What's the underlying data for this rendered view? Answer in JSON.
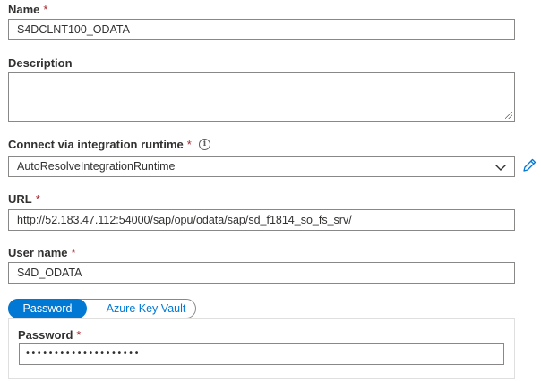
{
  "name": {
    "label": "Name",
    "required_marker": "*",
    "value": "S4DCLNT100_ODATA"
  },
  "description": {
    "label": "Description",
    "value": ""
  },
  "integration_runtime": {
    "label": "Connect via integration runtime",
    "required_marker": "*",
    "info_glyph": "i",
    "selected": "AutoResolveIntegrationRuntime"
  },
  "url": {
    "label": "URL",
    "required_marker": "*",
    "value": "http://52.183.47.112:54000/sap/opu/odata/sap/sd_f1814_so_fs_srv/"
  },
  "username": {
    "label": "User name",
    "required_marker": "*",
    "value": "S4D_ODATA"
  },
  "auth_toggle": {
    "options": [
      "Password",
      "Azure Key Vault"
    ],
    "selected": "Password"
  },
  "password": {
    "label": "Password",
    "required_marker": "*",
    "masked_value": "••••••••••••••••••••"
  },
  "colors": {
    "accent": "#0078d4",
    "required": "#a4262c",
    "border": "#8a8886",
    "text": "#323130"
  },
  "icons": {
    "info": "info-icon",
    "edit": "pencil-icon",
    "dropdown": "chevron-down-icon",
    "resize": "resize-grip-icon"
  }
}
